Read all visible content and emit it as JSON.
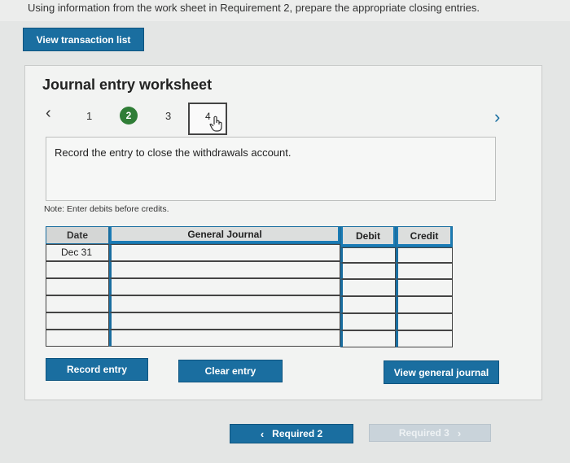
{
  "instructions": "Using information from the work sheet in Requirement 2, prepare the appropriate closing entries.",
  "buttons": {
    "view_transactions": "View transaction list",
    "record_entry": "Record entry",
    "clear_entry": "Clear entry",
    "view_general_journal": "View general journal"
  },
  "worksheet": {
    "title": "Journal entry worksheet",
    "steps": [
      "1",
      "2",
      "3",
      "4"
    ],
    "active_step": "2",
    "current_step": "4",
    "prompt": "Record the entry to close the withdrawals account.",
    "note": "Note: Enter debits before credits."
  },
  "table": {
    "headers": {
      "date": "Date",
      "journal": "General Journal",
      "debit": "Debit",
      "credit": "Credit"
    },
    "rows": [
      {
        "date": "Dec 31",
        "account": "",
        "debit": "",
        "credit": ""
      },
      {
        "date": "",
        "account": "",
        "debit": "",
        "credit": ""
      },
      {
        "date": "",
        "account": "",
        "debit": "",
        "credit": ""
      },
      {
        "date": "",
        "account": "",
        "debit": "",
        "credit": ""
      },
      {
        "date": "",
        "account": "",
        "debit": "",
        "credit": ""
      },
      {
        "date": "",
        "account": "",
        "debit": "",
        "credit": ""
      }
    ]
  },
  "pager": {
    "prev_label": "Required 2",
    "next_label": "Required 3"
  },
  "colors": {
    "accent": "#1a6ea0",
    "active_step": "#2f7d36"
  }
}
